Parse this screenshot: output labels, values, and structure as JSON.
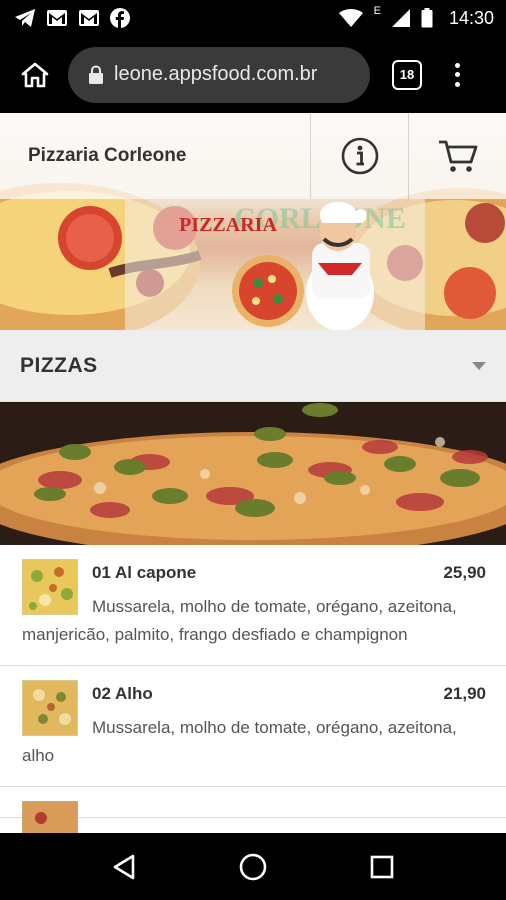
{
  "status_bar": {
    "time": "14:30",
    "network_label": "E",
    "icons": [
      "telegram-icon",
      "gmail-icon",
      "gmail-icon",
      "facebook-icon",
      "wifi-icon",
      "signal-icon",
      "battery-icon"
    ]
  },
  "browser": {
    "url": "leone.appsfood.com.br",
    "tab_count": "18"
  },
  "store": {
    "title": "Pizzaria Corleone",
    "banner_brand": "CORLEONE",
    "banner_sub": "PIZZARIA"
  },
  "category": {
    "title": "PIZZAS"
  },
  "products": [
    {
      "name": "01 Al capone",
      "price": "25,90",
      "description": "Mussarela, molho de tomate, orégano, azeitona, manjericão, palmito, frango desfiado e champignon"
    },
    {
      "name": "02 Alho",
      "price": "21,90",
      "description": "Mussarela, molho de tomate, orégano, azeitona, alho"
    }
  ],
  "colors": {
    "status_bar_bg": "#000000",
    "url_pill_bg": "#3a3a3a",
    "category_bar_bg": "#eeeeee",
    "text_dark": "#333333"
  }
}
